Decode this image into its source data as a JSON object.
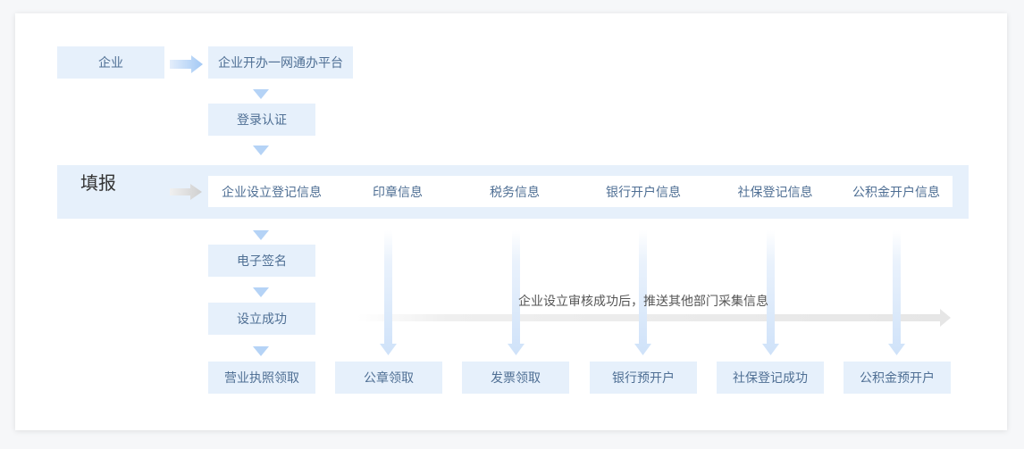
{
  "flow": {
    "enterprise": "企业",
    "platform": "企业开办一网通办平台",
    "login": "登录认证",
    "fill_label": "填报",
    "fill_items": [
      "企业设立登记信息",
      "印章信息",
      "税务信息",
      "银行开户信息",
      "社保登记信息",
      "公积金开户信息"
    ],
    "signature": "电子签名",
    "established": "设立成功",
    "note": "企业设立审核成功后，推送其他部门采集信息",
    "results": [
      "营业执照领取",
      "公章领取",
      "发票领取",
      "银行预开户",
      "社保登记成功",
      "公积金预开户"
    ]
  },
  "colors": {
    "box_bg": "#e6f0fb",
    "box_text": "#4f6f94",
    "arrow_blue": "#a9cdf7",
    "arrow_gray": "#d6d6d6"
  }
}
